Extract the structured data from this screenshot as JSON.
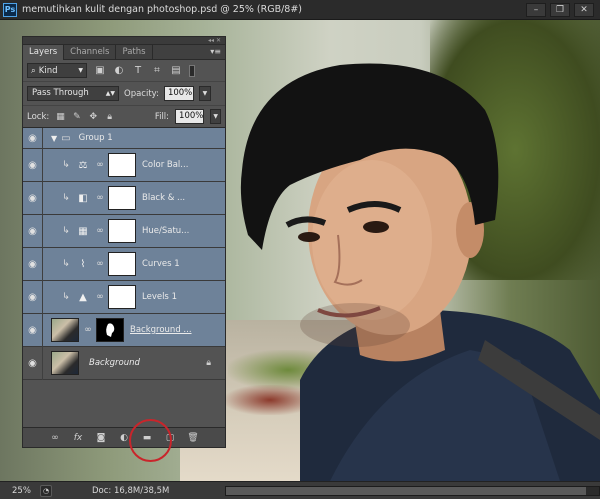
{
  "window": {
    "app_icon": "Ps",
    "title": "memutihkan kulit dengan photoshop.psd @ 25% (RGB/8#)",
    "controls": [
      "minimize-icon",
      "restore-icon",
      "close-icon"
    ]
  },
  "panel": {
    "tabs": [
      {
        "label": "Layers",
        "active": true
      },
      {
        "label": "Channels",
        "active": false
      },
      {
        "label": "Paths",
        "active": false
      }
    ],
    "filter": {
      "kind_label": "Kind",
      "icons": [
        "image-filter-icon",
        "adjustment-filter-icon",
        "type-filter-icon",
        "shape-filter-icon",
        "smart-object-filter-icon"
      ]
    },
    "blend_mode": "Pass Through",
    "opacity_label": "Opacity:",
    "opacity_value": "100%",
    "lock_label": "Lock:",
    "fill_label": "Fill:",
    "fill_value": "100%",
    "layers": [
      {
        "name": "Group 1",
        "type": "group",
        "selected": true
      },
      {
        "name": "Color Bal...",
        "type": "adjustment",
        "icon": "color-balance-icon",
        "selected": true
      },
      {
        "name": "Black & ...",
        "type": "adjustment",
        "icon": "black-white-icon",
        "selected": true
      },
      {
        "name": "Hue/Satu...",
        "type": "adjustment",
        "icon": "hue-saturation-icon",
        "selected": true
      },
      {
        "name": "Curves 1",
        "type": "adjustment",
        "icon": "curves-icon",
        "selected": true
      },
      {
        "name": "Levels 1",
        "type": "adjustment",
        "icon": "levels-icon",
        "selected": true
      },
      {
        "name": "Background ...",
        "type": "masked-layer",
        "selected": true
      },
      {
        "name": "Background",
        "type": "background",
        "selected": false,
        "locked": true
      }
    ],
    "footer_icons": [
      "link-layers-icon",
      "fx-icon",
      "add-mask-icon",
      "adjustment-layer-icon",
      "new-group-icon",
      "new-layer-icon",
      "trash-icon"
    ]
  },
  "status": {
    "zoom": "25%",
    "doc": "Doc: 16,8M/38,5M"
  }
}
